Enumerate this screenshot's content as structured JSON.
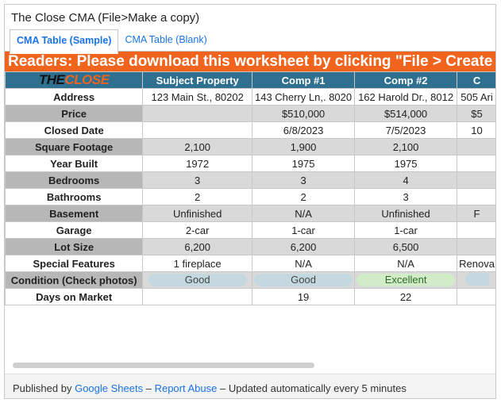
{
  "window": {
    "title": "The Close CMA (File>Make a copy)"
  },
  "tabs": [
    {
      "label": "CMA Table (Sample)",
      "active": true
    },
    {
      "label": "CMA Table (Blank)",
      "active": false
    }
  ],
  "banner": "Readers: Please download this worksheet by clicking \"File > Create",
  "logo": {
    "the": "THE",
    "close": "CLOSE"
  },
  "header": [
    "Subject Property",
    "Comp #1",
    "Comp #2",
    "C"
  ],
  "rows": [
    {
      "label": "Address",
      "cells": [
        "123 Main St., 80202",
        "143 Cherry Ln,. 8020",
        "162 Harold Dr., 8012",
        "505 Ari"
      ]
    },
    {
      "label": "Price",
      "cells": [
        "",
        "$510,000",
        "$514,000",
        "$5"
      ]
    },
    {
      "label": "Closed Date",
      "cells": [
        "",
        "6/8/2023",
        "7/5/2023",
        "10"
      ]
    },
    {
      "label": "Square Footage",
      "cells": [
        "2,100",
        "1,900",
        "2,100",
        ""
      ]
    },
    {
      "label": "Year Built",
      "cells": [
        "1972",
        "1975",
        "1975",
        ""
      ]
    },
    {
      "label": "Bedrooms",
      "cells": [
        "3",
        "3",
        "4",
        ""
      ]
    },
    {
      "label": "Bathrooms",
      "cells": [
        "2",
        "2",
        "3",
        ""
      ]
    },
    {
      "label": "Basement",
      "cells": [
        "Unfinished",
        "N/A",
        "Unfinished",
        "F"
      ]
    },
    {
      "label": "Garage",
      "cells": [
        "2-car",
        "1-car",
        "1-car",
        ""
      ]
    },
    {
      "label": "Lot Size",
      "cells": [
        "6,200",
        "6,200",
        "6,500",
        ""
      ]
    },
    {
      "label": "Special Features",
      "cells": [
        "1 fireplace",
        "N/A",
        "N/A",
        "Renova"
      ]
    },
    {
      "label": "Condition (Check photos)",
      "cells": [
        "Good",
        "Good",
        "Excellent",
        ""
      ]
    },
    {
      "label": "Days on Market",
      "cells": [
        "",
        "19",
        "22",
        ""
      ]
    }
  ],
  "footer": {
    "published_by": "Published by",
    "google_sheets": "Google Sheets",
    "sep1": "–",
    "report_abuse": "Report Abuse",
    "sep2": "–",
    "updated": "Updated automatically every 5 minutes"
  },
  "colors": {
    "accent": "#f1641e",
    "header": "#2f6f8f",
    "link": "#1a73e8"
  }
}
